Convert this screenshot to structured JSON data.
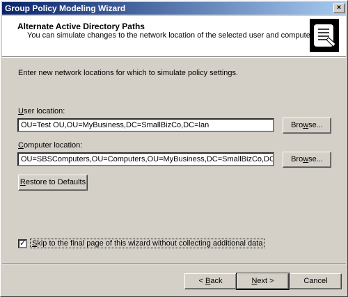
{
  "window": {
    "title": "Group Policy Modeling Wizard",
    "close_glyph": "×"
  },
  "header": {
    "title": "Alternate Active Directory Paths",
    "subtitle": "You can simulate changes to the network location of the selected user and computer.",
    "icon": "scroll-document-icon"
  },
  "intro_text": "Enter new network locations for which to simulate policy settings.",
  "user_location": {
    "label_mnemonic": "U",
    "label_rest": "ser location:",
    "value": "OU=Test OU,OU=MyBusiness,DC=SmallBizCo,DC=lan",
    "browse_mnemonic": "w",
    "browse_pre": "Bro",
    "browse_post": "se..."
  },
  "computer_location": {
    "label_mnemonic": "C",
    "label_rest": "omputer location:",
    "value": "OU=SBSComputers,OU=Computers,OU=MyBusiness,DC=SmallBizCo,DC=lan",
    "browse_mnemonic": "w",
    "browse_pre": "Bro",
    "browse_post": "se..."
  },
  "restore_button": {
    "mnemonic": "R",
    "rest": "estore to Defaults"
  },
  "skip_checkbox": {
    "checked": true,
    "check_glyph": "✓",
    "label_mnemonic": "S",
    "label_rest": "kip to the final page of this wizard without collecting additional data"
  },
  "footer": {
    "back_pre": "< ",
    "back_mnemonic": "B",
    "back_rest": "ack",
    "next_mnemonic": "N",
    "next_rest": "ext >",
    "cancel": "Cancel"
  }
}
